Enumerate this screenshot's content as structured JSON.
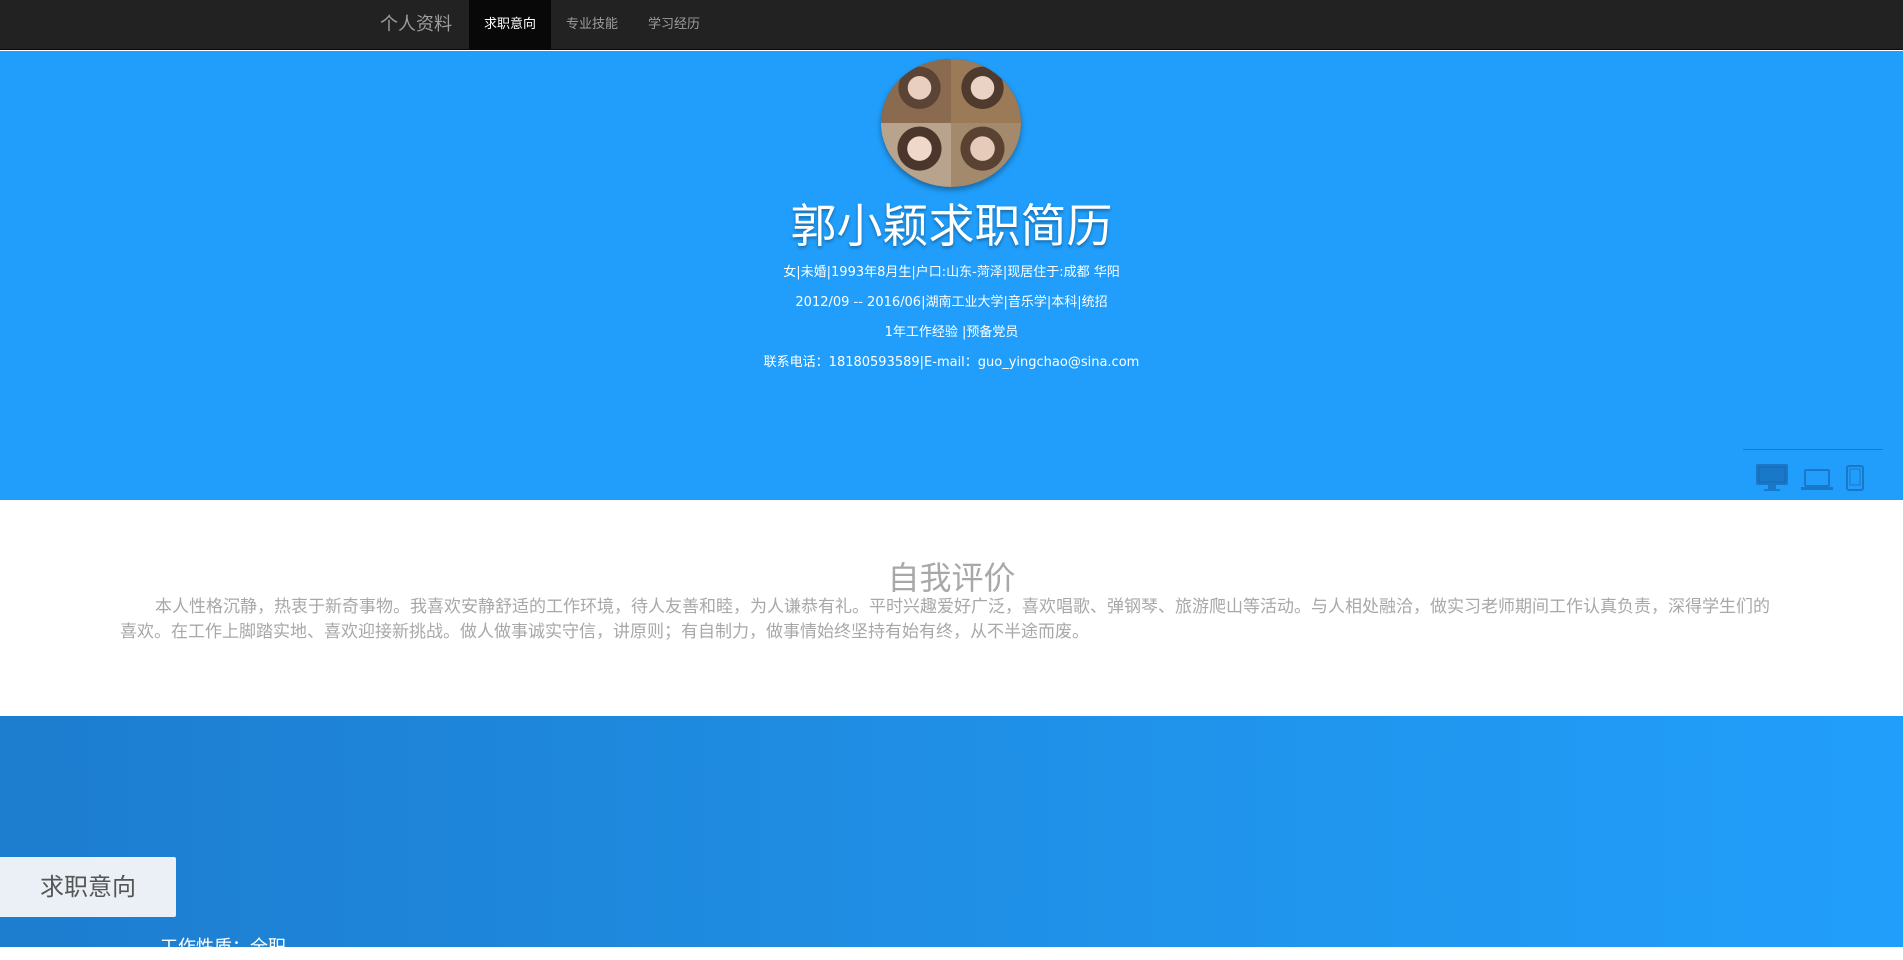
{
  "navbar": {
    "brand": "个人资料",
    "items": [
      {
        "label": "求职意向",
        "active": true
      },
      {
        "label": "专业技能",
        "active": false
      },
      {
        "label": "学习经历",
        "active": false
      }
    ]
  },
  "hero": {
    "title": "郭小颖求职简历",
    "lines": [
      "女|未婚|1993年8月生|户口:山东-菏泽|现居住于:成都 华阳",
      "2012/09 -- 2016/06|湖南工业大学|音乐学|本科|统招",
      "1年工作经验 |预备党员",
      "联系电话：18180593589|E-mail：guo_yingchao@sina.com"
    ],
    "background_color": "#219efb"
  },
  "device_switcher": {
    "icons": [
      "desktop-icon",
      "laptop-icon",
      "tablet-icon",
      "phone-icon"
    ]
  },
  "self_evaluation": {
    "title": "自我评价",
    "text": "本人性格沉静，热衷于新奇事物。我喜欢安静舒适的工作环境，待人友善和睦，为人谦恭有礼。平时兴趣爱好广泛，喜欢唱歌、弹钢琴、旅游爬山等活动。与人相处融洽，做实习老师期间工作认真负责，深得学生们的喜欢。在工作上脚踏实地、喜欢迎接新挑战。做人做事诚实守信，讲原则；有自制力，做事情始终坚持有始有终，从不半途而废。"
  },
  "job_intention": {
    "label": "求职意向",
    "nature": "工作性质：全职"
  }
}
